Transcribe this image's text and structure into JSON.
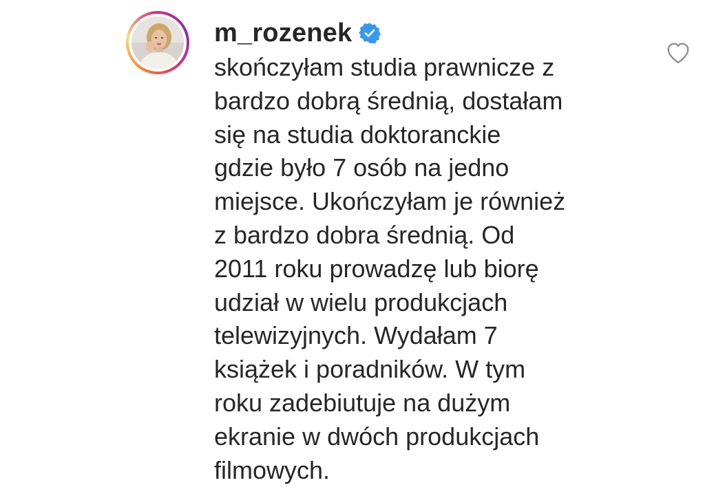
{
  "comment": {
    "username": "m_rozenek",
    "verified": true,
    "verified_badge_icon": "verified-badge-icon",
    "like_icon": "heart-outline-icon",
    "avatar_icon": "profile-avatar",
    "colors": {
      "verified_blue": "#3897f0",
      "text": "#262626",
      "heart_stroke": "#8e8e8e",
      "story_ring": [
        "#f58529",
        "#feda77",
        "#dd2a7b",
        "#8134af"
      ]
    },
    "text_lines": [
      "skończyłam studia prawnicze z",
      "bardzo dobrą średnią, dostałam",
      "się na studia doktoranckie",
      "gdzie było 7 osób na jedno",
      "miejsce. Ukończyłam je również",
      "z bardzo dobra średnią. Od",
      "2011 roku prowadzę lub biorę",
      "udział w wielu produkcjach",
      "telewizyjnych. Wydałam 7",
      "książek i poradników. W tym",
      "roku zadebiutuje na dużym",
      "ekranie w dwóch produkcjach",
      "filmowych."
    ]
  }
}
